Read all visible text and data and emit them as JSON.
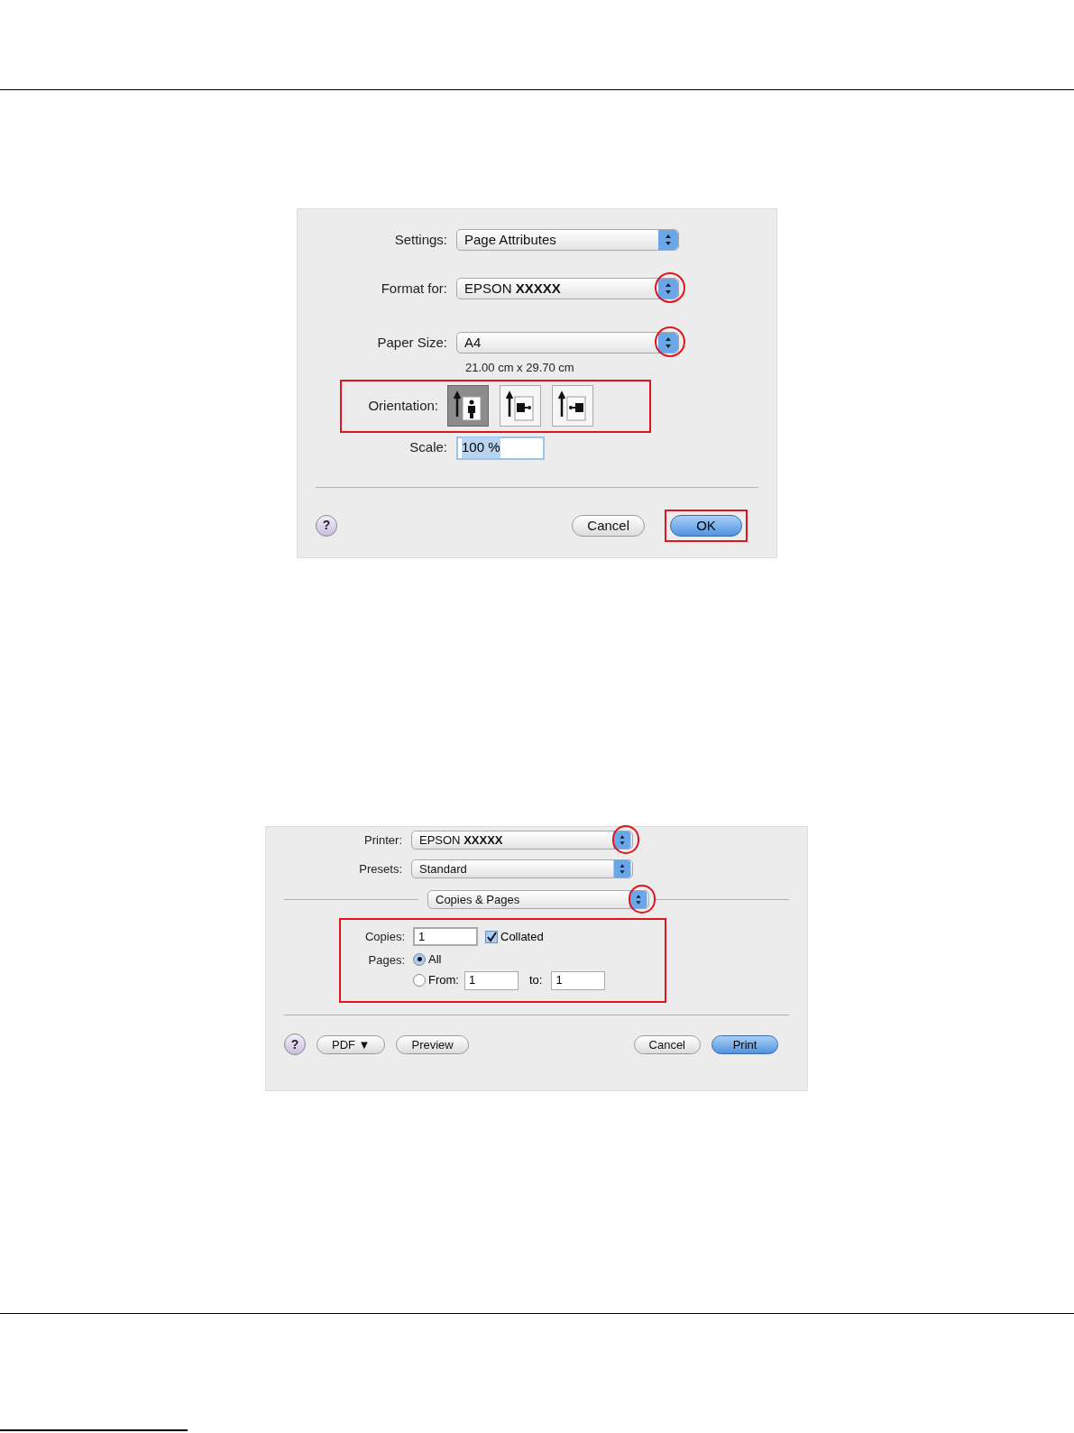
{
  "page_setup_dialog": {
    "rows": [
      {
        "label": "Settings:",
        "value": "Page Attributes",
        "highlighted": false
      },
      {
        "label": "Format for:",
        "value": "EPSON **XXXXX**",
        "highlighted": true
      },
      {
        "label": "Paper Size:",
        "value": "A4",
        "highlighted": true
      }
    ],
    "paper_dimensions": "21.00 cm x 29.70 cm",
    "orientation": {
      "label": "Orientation:",
      "highlighted": true,
      "options": [
        {
          "kind": "portrait",
          "selected": true
        },
        {
          "kind": "landscape",
          "selected": false
        },
        {
          "kind": "reverse_landscape",
          "selected": false
        }
      ]
    },
    "scale": {
      "label": "Scale:",
      "value": "100 %"
    },
    "help": "?",
    "buttons": [
      {
        "label": "Cancel",
        "default": false,
        "highlighted": false
      },
      {
        "label": "OK",
        "default": true,
        "highlighted": true
      }
    ]
  },
  "print_dialog": {
    "rows": [
      {
        "label": "Printer:",
        "value": "EPSON **XXXXX**",
        "highlighted": true
      },
      {
        "label": "Presets:",
        "value": "Standard",
        "highlighted": false
      }
    ],
    "panel": {
      "value": "Copies & Pages",
      "highlighted": true
    },
    "copies_pages": {
      "highlighted": true,
      "copies_label": "Copies:",
      "copies": "1",
      "collated": {
        "label": "Collated",
        "checked": true
      },
      "pages_label": "Pages:",
      "pages_options": [
        {
          "label": "All",
          "selected": true
        },
        {
          "label": "From:",
          "selected": false
        }
      ],
      "from": "1",
      "to_label": "to:",
      "to": "1"
    },
    "help": "?",
    "left_buttons": [
      {
        "label": "PDF ▼"
      },
      {
        "label": "Preview"
      }
    ],
    "buttons": [
      {
        "label": "Cancel",
        "default": false
      },
      {
        "label": "Print",
        "default": true
      }
    ]
  }
}
